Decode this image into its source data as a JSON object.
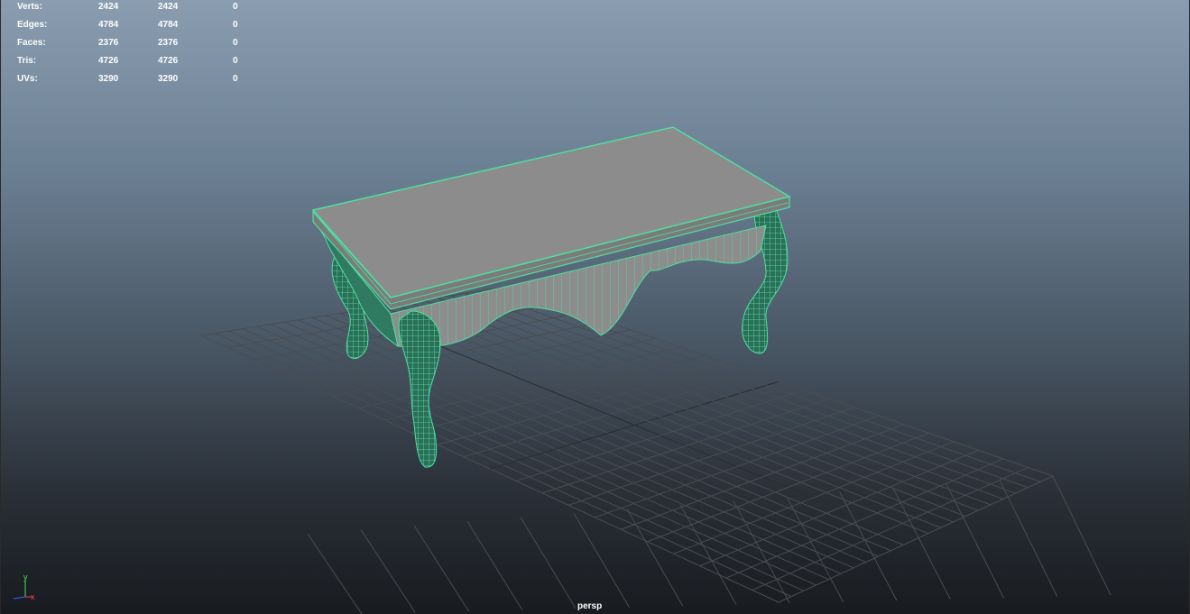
{
  "hud": {
    "rows": [
      {
        "label": "Verts:",
        "v1": "2424",
        "v2": "2424",
        "v3": "0"
      },
      {
        "label": "Edges:",
        "v1": "4784",
        "v2": "4784",
        "v3": "0"
      },
      {
        "label": "Faces:",
        "v1": "2376",
        "v2": "2376",
        "v3": "0"
      },
      {
        "label": "Tris:",
        "v1": "4726",
        "v2": "4726",
        "v3": "0"
      },
      {
        "label": "UVs:",
        "v1": "3290",
        "v2": "3290",
        "v3": "0"
      }
    ]
  },
  "viewport": {
    "camera_label": "persp",
    "axis": {
      "y": "y",
      "x": "x"
    },
    "object": "table-mesh",
    "wire_color": "#4de0a0",
    "surface_color": "#8c8c8c"
  }
}
